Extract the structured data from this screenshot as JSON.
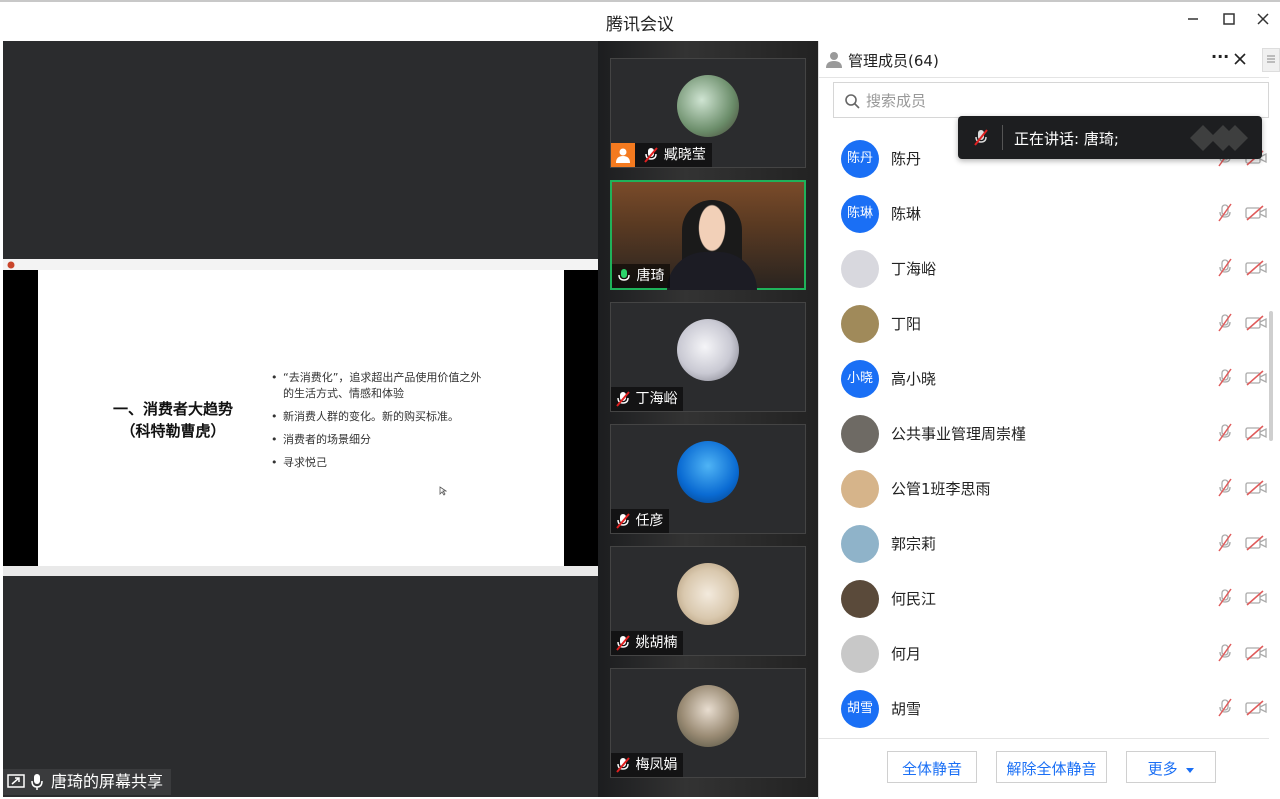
{
  "window": {
    "title": "腾讯会议",
    "minimize": "✕",
    "maximize": "☐",
    "close": "✕"
  },
  "presentation": {
    "slide_title_line1": "一、消费者大趋势",
    "slide_title_line2": "（科特勒曹虎）",
    "bullets": [
      "“去消费化”，追求超出产品使用价值之外的生活方式、情感和体验",
      "新消费人群的变化。新的购买标准。",
      "消费者的场景细分",
      "寻求悦己"
    ]
  },
  "share_bar": {
    "label": "唐琦的屏幕共享"
  },
  "video_tiles": [
    {
      "name": "臧晓莹"
    },
    {
      "name": "唐琦"
    },
    {
      "name": "丁海峪"
    },
    {
      "name": "任彦"
    },
    {
      "name": "姚胡楠"
    },
    {
      "name": "梅凤娟"
    }
  ],
  "panel": {
    "title": "管理成员(64)",
    "more": "···",
    "close": "✕",
    "search_placeholder": "搜索成员"
  },
  "speaking_toast": {
    "text": "正在讲话: 唐琦;"
  },
  "members": [
    {
      "name": "陈丹",
      "avatar_text": "陈丹",
      "avatar_color": "#1a6ff5"
    },
    {
      "name": "陈琳",
      "avatar_text": "陈琳",
      "avatar_color": "#1a6ff5"
    },
    {
      "name": "丁海峪",
      "avatar_text": "",
      "avatar_color": "#d8d8de"
    },
    {
      "name": "丁阳",
      "avatar_text": "",
      "avatar_color": "#a08a5a"
    },
    {
      "name": "高小晓",
      "avatar_text": "小晓",
      "avatar_color": "#1a6ff5"
    },
    {
      "name": "公共事业管理周崇槿",
      "avatar_text": "",
      "avatar_color": "#6e6a64"
    },
    {
      "name": "公管1班李思雨",
      "avatar_text": "",
      "avatar_color": "#d6b48a"
    },
    {
      "name": "郭宗莉",
      "avatar_text": "",
      "avatar_color": "#8fb3c9"
    },
    {
      "name": "何民江",
      "avatar_text": "",
      "avatar_color": "#5a4a3a"
    },
    {
      "name": "何月",
      "avatar_text": "",
      "avatar_color": "#c8c8c8"
    },
    {
      "name": "胡雪",
      "avatar_text": "胡雪",
      "avatar_color": "#1a6ff5"
    }
  ],
  "footer": {
    "mute_all": "全体静音",
    "unmute_all": "解除全体静音",
    "more": "更多"
  }
}
